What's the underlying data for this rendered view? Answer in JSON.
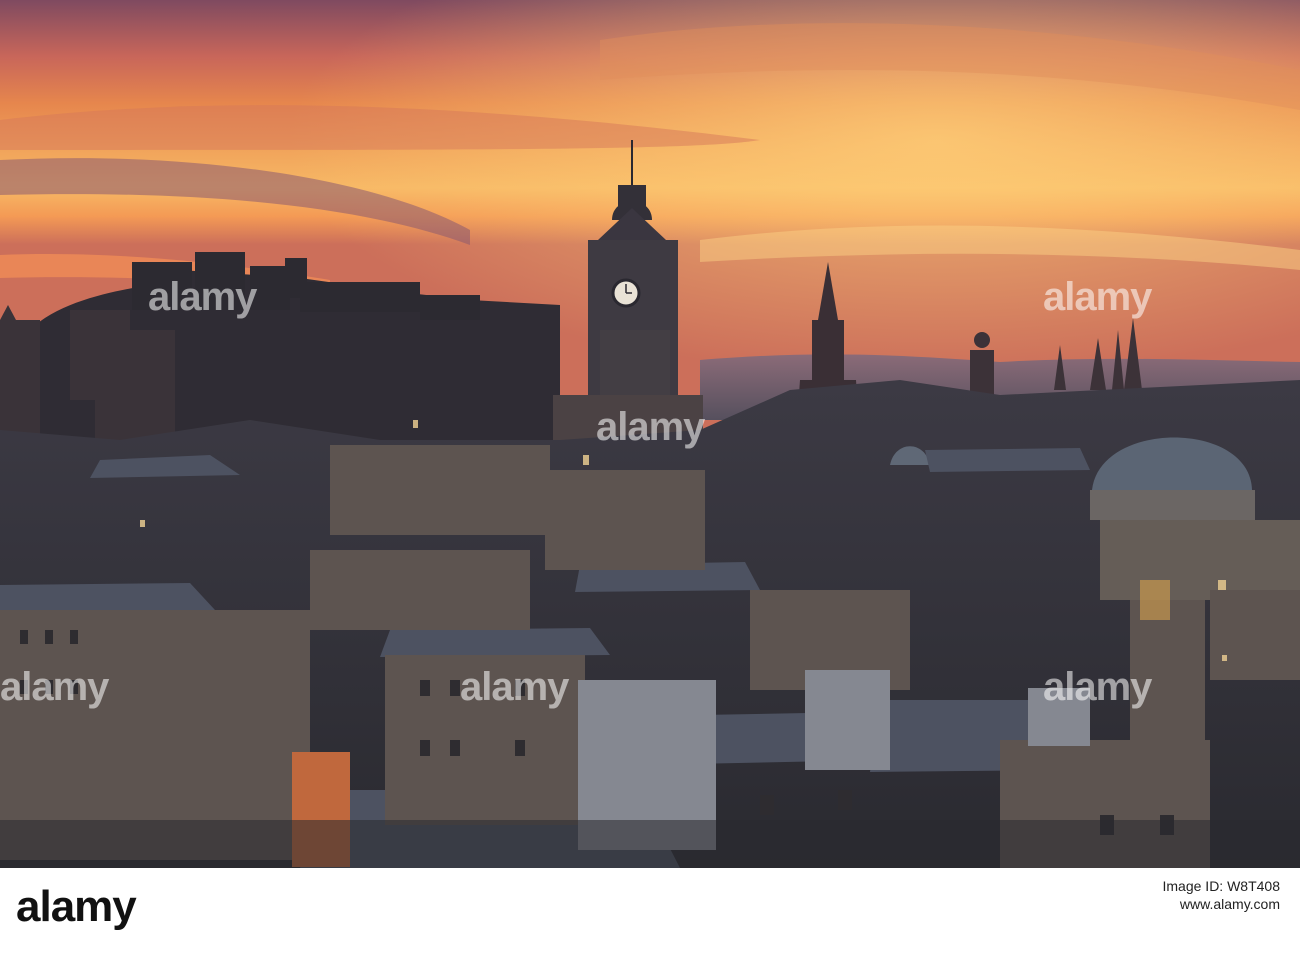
{
  "watermark": {
    "text": "alamy"
  },
  "footer": {
    "logo_text": "alamy",
    "image_id_label": "Image ID: W8T408",
    "site": "www.alamy.com"
  },
  "colors": {
    "sky_top": "#8a4a5e",
    "sky_mid": "#e27a48",
    "sky_glow": "#f6b15c",
    "horizon": "#f58a4a",
    "silhouette": "#2b2a33",
    "roofs": "#4b4f5c",
    "stone": "#6d625a"
  }
}
